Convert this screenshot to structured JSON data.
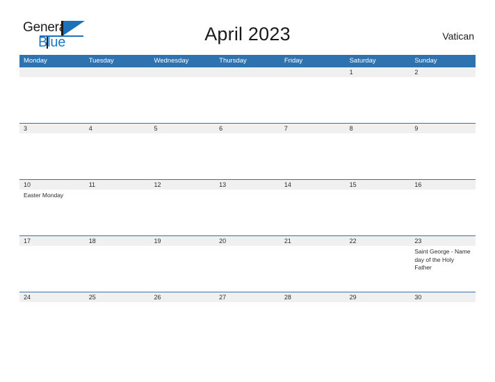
{
  "brand": {
    "name_part1": "General",
    "name_part2": "Blue",
    "flag_color": "#1b72b8",
    "text_color": "#1a1a1a"
  },
  "header": {
    "title": "April 2023",
    "region": "Vatican"
  },
  "colors": {
    "header_blue": "#2e72b0",
    "date_band_gray": "#f0f0f0",
    "page_background": "#ffffff",
    "text": "#2b2b2b"
  },
  "calendar": {
    "weekdays": [
      "Monday",
      "Tuesday",
      "Wednesday",
      "Thursday",
      "Friday",
      "Saturday",
      "Sunday"
    ],
    "weeks": [
      {
        "days": [
          {
            "num": "",
            "events": []
          },
          {
            "num": "",
            "events": []
          },
          {
            "num": "",
            "events": []
          },
          {
            "num": "",
            "events": []
          },
          {
            "num": "",
            "events": []
          },
          {
            "num": "1",
            "events": []
          },
          {
            "num": "2",
            "events": []
          }
        ]
      },
      {
        "days": [
          {
            "num": "3",
            "events": []
          },
          {
            "num": "4",
            "events": []
          },
          {
            "num": "5",
            "events": []
          },
          {
            "num": "6",
            "events": []
          },
          {
            "num": "7",
            "events": []
          },
          {
            "num": "8",
            "events": []
          },
          {
            "num": "9",
            "events": []
          }
        ]
      },
      {
        "days": [
          {
            "num": "10",
            "events": [
              "Easter Monday"
            ]
          },
          {
            "num": "11",
            "events": []
          },
          {
            "num": "12",
            "events": []
          },
          {
            "num": "13",
            "events": []
          },
          {
            "num": "14",
            "events": []
          },
          {
            "num": "15",
            "events": []
          },
          {
            "num": "16",
            "events": []
          }
        ]
      },
      {
        "days": [
          {
            "num": "17",
            "events": []
          },
          {
            "num": "18",
            "events": []
          },
          {
            "num": "19",
            "events": []
          },
          {
            "num": "20",
            "events": []
          },
          {
            "num": "21",
            "events": []
          },
          {
            "num": "22",
            "events": []
          },
          {
            "num": "23",
            "events": [
              "Saint George - Name day of the Holy Father"
            ]
          }
        ]
      },
      {
        "days": [
          {
            "num": "24",
            "events": []
          },
          {
            "num": "25",
            "events": []
          },
          {
            "num": "26",
            "events": []
          },
          {
            "num": "27",
            "events": []
          },
          {
            "num": "28",
            "events": []
          },
          {
            "num": "29",
            "events": []
          },
          {
            "num": "30",
            "events": []
          }
        ]
      }
    ]
  }
}
